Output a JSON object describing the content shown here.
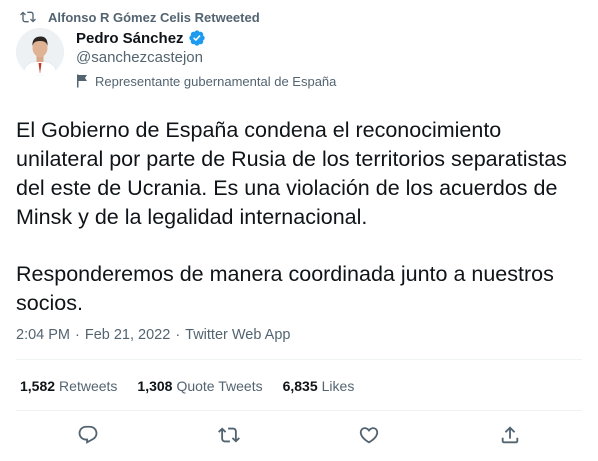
{
  "retweet_header": {
    "icon": "retweet-icon",
    "text": "Alfonso R Gómez Celis Retweeted"
  },
  "author": {
    "name": "Pedro Sánchez",
    "verified": true,
    "verified_icon": "verified-badge-icon",
    "handle": "@sanchezcastejon",
    "label_icon": "flag-icon",
    "label": "Representante gubernamental de España"
  },
  "tweet": {
    "paragraphs": [
      "El Gobierno de España condena el reconocimiento unilateral por parte de Rusia de los territorios separatistas del este de Ucrania. Es una violación de los acuerdos de Minsk y de la legalidad internacional.",
      "Responderemos de manera coordinada junto a nuestros socios."
    ]
  },
  "meta": {
    "time": "2:04 PM",
    "separator": "·",
    "date": "Feb 21, 2022",
    "source": "Twitter Web App"
  },
  "stats": {
    "retweets_count": "1,582",
    "retweets_label": "Retweets",
    "quotes_count": "1,308",
    "quotes_label": "Quote Tweets",
    "likes_count": "6,835",
    "likes_label": "Likes"
  },
  "actions": {
    "reply_icon": "reply-icon",
    "retweet_icon": "retweet-icon",
    "like_icon": "heart-icon",
    "share_icon": "share-icon"
  },
  "colors": {
    "text_primary": "#0f1419",
    "text_secondary": "#536471",
    "verified_blue": "#1d9bf0",
    "divider": "#eff3f4"
  }
}
